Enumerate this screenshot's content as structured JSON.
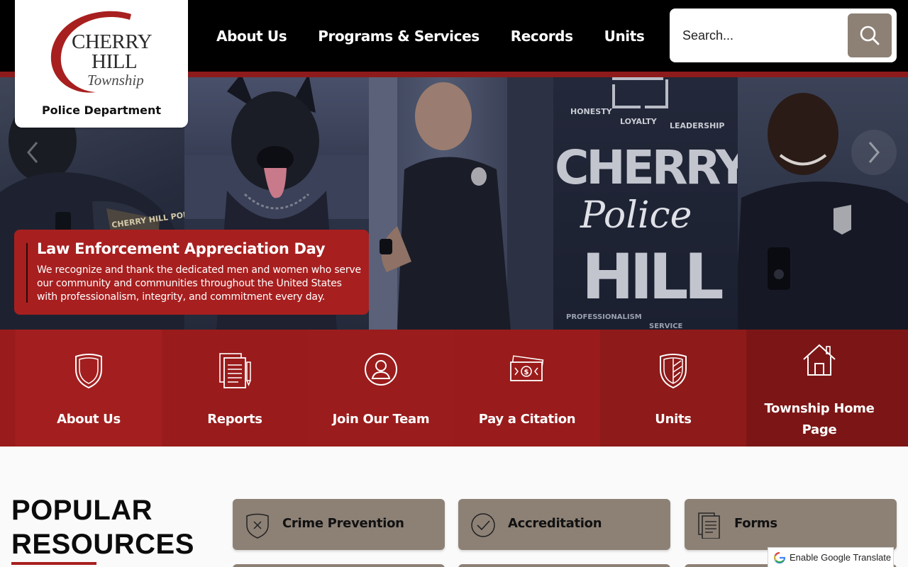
{
  "logo": {
    "wordmark_line1": "CHERRY",
    "wordmark_line2": "HILL",
    "wordmark_script": "Township",
    "department": "Police Department"
  },
  "nav": {
    "items": [
      "About Us",
      "Programs & Services",
      "Records",
      "Units"
    ]
  },
  "search": {
    "placeholder": "Search..."
  },
  "hero": {
    "caption_title": "Law Enforcement Appreciation Day",
    "caption_text": "We recognize and thank the dedicated men and women who serve our community and communities throughout the United States with professionalism, integrity, and commitment every day.",
    "mural_words": [
      "HONESTY",
      "LOYALTY",
      "LEADERSHIP",
      "CHERRY",
      "Police",
      "HILL",
      "PROFESSIONALISM",
      "SERVICE"
    ],
    "badge_text": "CHERRY HILL POLICE N.J."
  },
  "quick_links": [
    {
      "label": "About Us",
      "icon": "shield-icon"
    },
    {
      "label": "Reports",
      "icon": "document-icon"
    },
    {
      "label": "Join Our Team",
      "icon": "user-icon"
    },
    {
      "label": "Pay a Citation",
      "icon": "money-icon"
    },
    {
      "label": "Units",
      "icon": "striped-shield-icon"
    },
    {
      "label": "Township Home Page",
      "icon": "house-icon"
    }
  ],
  "popular": {
    "title_line1": "POPULAR",
    "title_line2": "RESOURCES",
    "items": [
      {
        "label": "Crime Prevention",
        "icon": "shield-x-icon"
      },
      {
        "label": "Accreditation",
        "icon": "check-circle-icon"
      },
      {
        "label": "Forms",
        "icon": "forms-icon"
      }
    ]
  },
  "translate": {
    "label": "Enable Google Translate"
  },
  "colors": {
    "brand_red": "#a81f1f",
    "dark_red": "#8e1b1b",
    "taupe": "#8d8176",
    "header_black": "#000000"
  }
}
